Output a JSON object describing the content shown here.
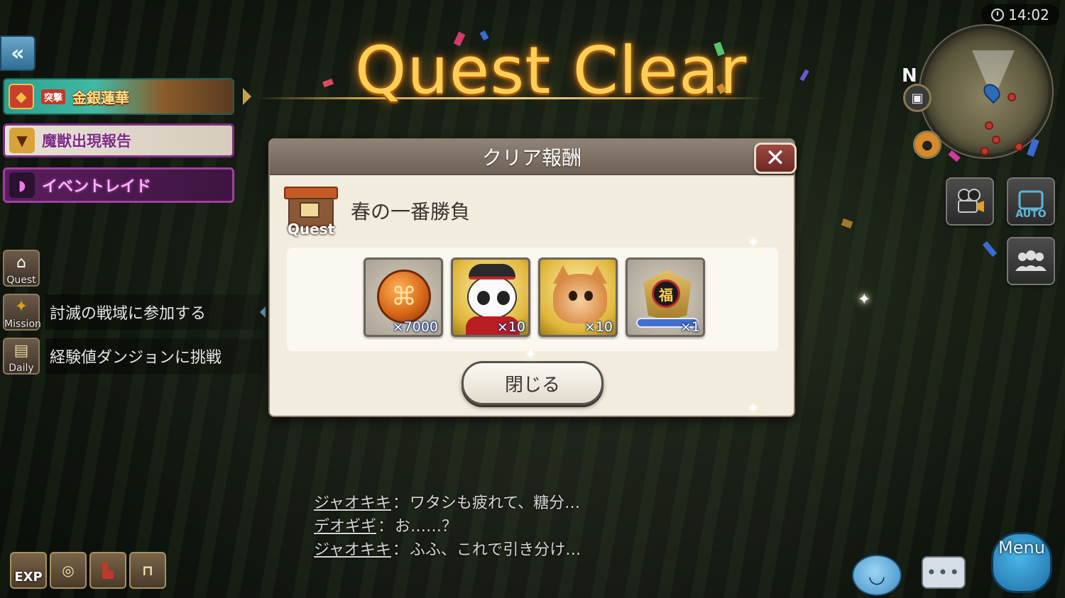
{
  "title": "Quest Clear",
  "clock": {
    "time": "14:02"
  },
  "minimap": {
    "north_label": "N"
  },
  "left_banners": {
    "event_text": "金銀蓮華",
    "event_sub": "突撃",
    "monster_report": "魔獣出現報告",
    "event_raid": "イベントレイド"
  },
  "quest_list": [
    {
      "icon_label": "Quest",
      "text": ""
    },
    {
      "icon_label": "Mission",
      "text": "討滅の戦域に参加する"
    },
    {
      "icon_label": "Daily",
      "text": "経験値ダンジョンに挑戦"
    }
  ],
  "dialog": {
    "header": "クリア報酬",
    "close_icon": "close-icon",
    "quest_badge_label": "Quest",
    "quest_name": "春の一番勝負",
    "rewards": [
      {
        "name": "coin",
        "count": "×7000"
      },
      {
        "name": "panda",
        "count": "×10"
      },
      {
        "name": "cat",
        "count": "×10"
      },
      {
        "name": "emblem",
        "count": "×1"
      }
    ],
    "close_button": "閉じる"
  },
  "right_buttons": {
    "auto_label": "AUTO"
  },
  "chat": [
    {
      "speaker": "ジャオキキ",
      "message": "ワタシも疲れて、糖分…"
    },
    {
      "speaker": "デオギギ",
      "message": "お……？"
    },
    {
      "speaker": "ジャオキキ",
      "message": "ふふ、これで引き分け…"
    }
  ],
  "bottom_left": {
    "exp_label": "EXP"
  },
  "bottom_right": {
    "menu_label": "Menu"
  },
  "colors": {
    "title_gold": "#ffcf55",
    "dialog_bg": "#f2ecdf",
    "header_bg": "#7f7266"
  }
}
